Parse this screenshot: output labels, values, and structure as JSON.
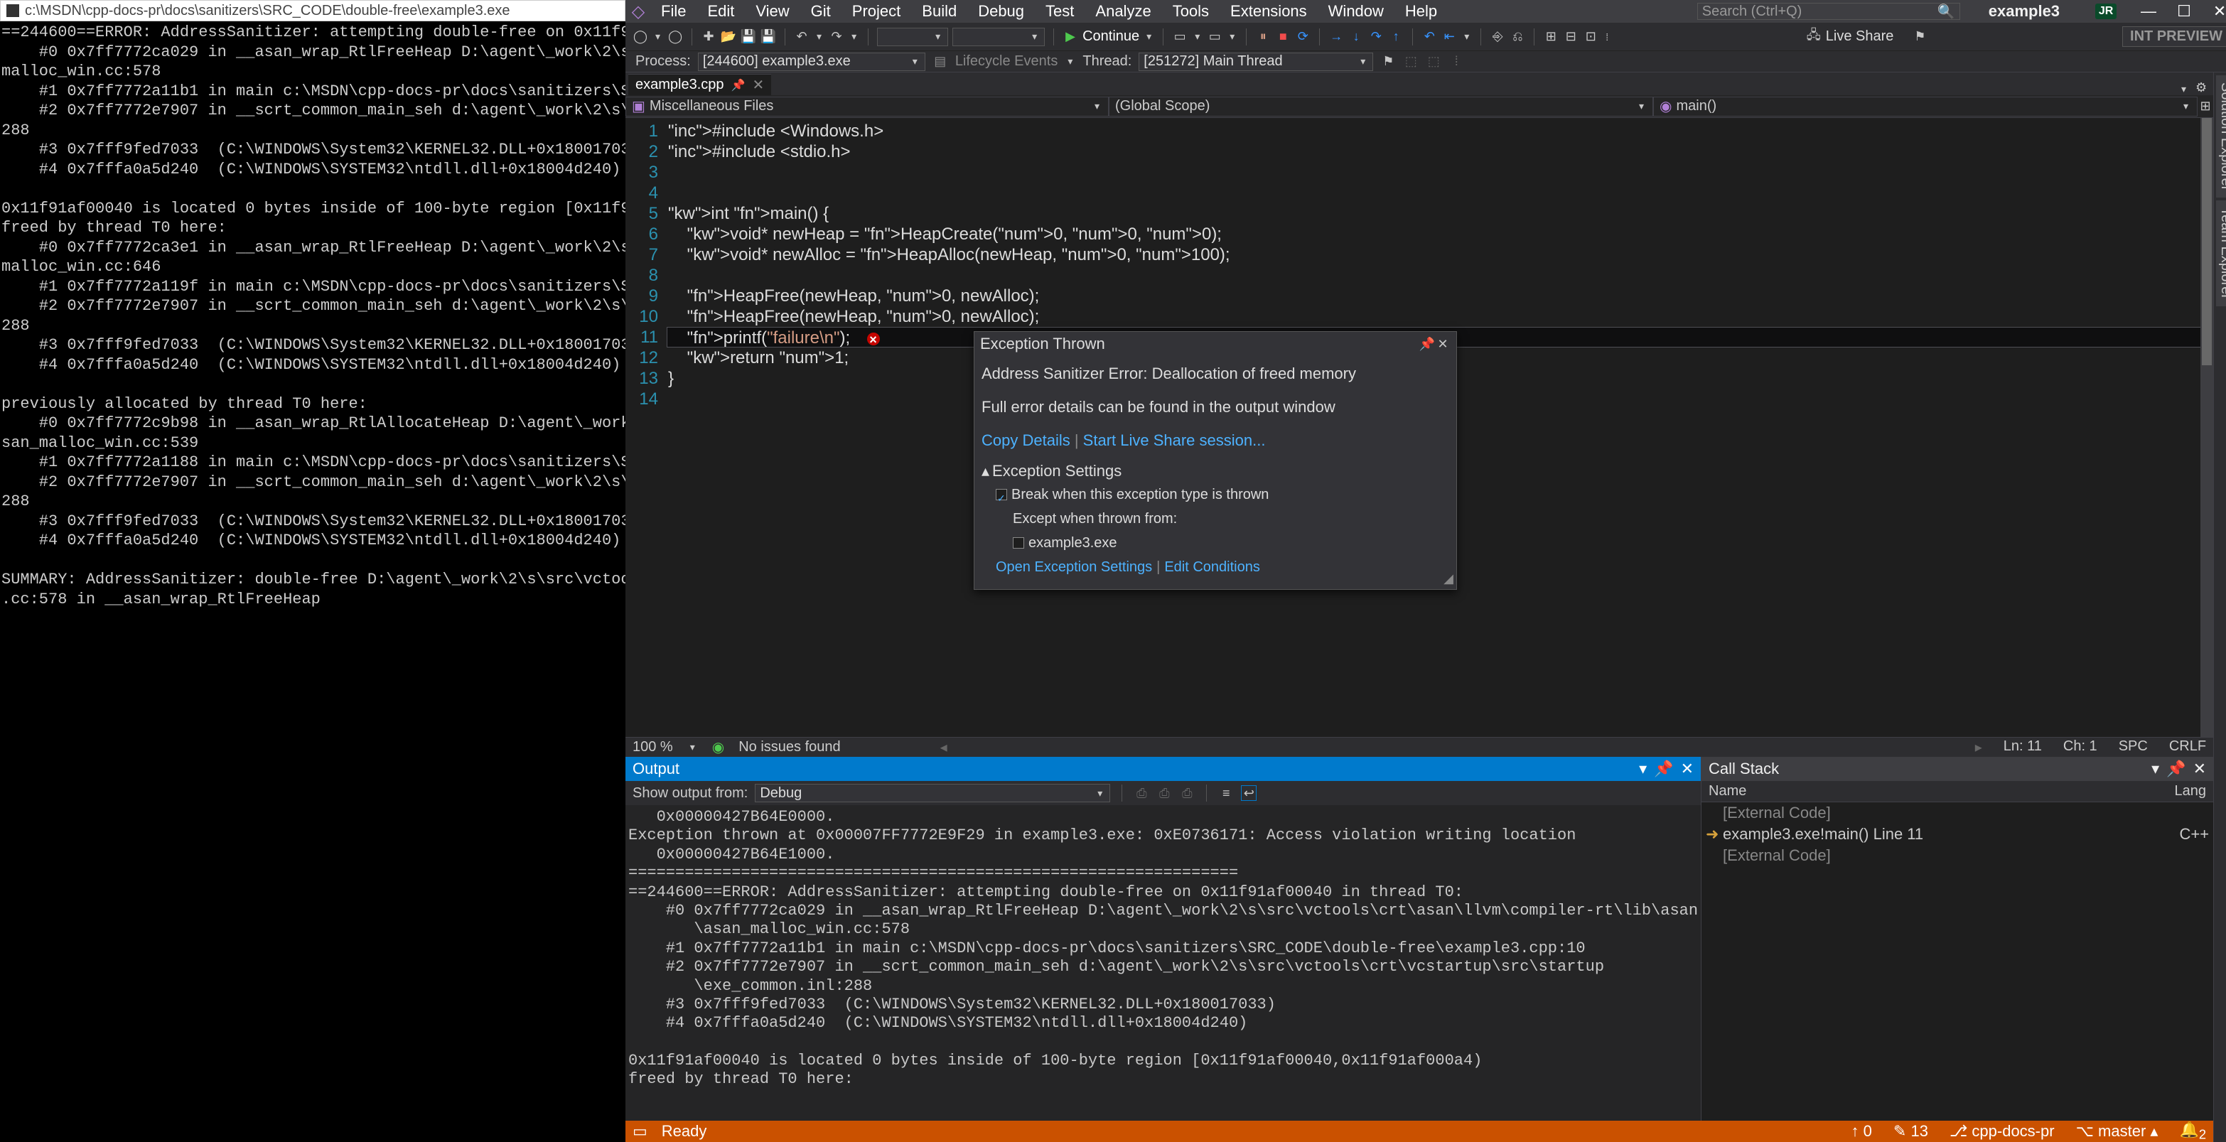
{
  "console": {
    "title": "c:\\MSDN\\cpp-docs-pr\\docs\\sanitizers\\SRC_CODE\\double-free\\example3.exe",
    "text": "==244600==ERROR: AddressSanitizer: attempting double-free on 0x11f91a\n    #0 0x7ff7772ca029 in __asan_wrap_RtlFreeHeap D:\\agent\\_work\\2\\s\\s\nmalloc_win.cc:578\n    #1 0x7ff7772a11b1 in main c:\\MSDN\\cpp-docs-pr\\docs\\sanitizers\\SRC\n    #2 0x7ff7772e7907 in __scrt_common_main_seh d:\\agent\\_work\\2\\s\\sr\n288\n    #3 0x7fff9fed7033  (C:\\WINDOWS\\System32\\KERNEL32.DLL+0x180017033)\n    #4 0x7fffa0a5d240  (C:\\WINDOWS\\SYSTEM32\\ntdll.dll+0x18004d240)\n\n0x11f91af00040 is located 0 bytes inside of 100-byte region [0x11f91a\nfreed by thread T0 here:\n    #0 0x7ff7772ca3e1 in __asan_wrap_RtlFreeHeap D:\\agent\\_work\\2\\s\\s\nmalloc_win.cc:646\n    #1 0x7ff7772a119f in main c:\\MSDN\\cpp-docs-pr\\docs\\sanitizers\\SRC\n    #2 0x7ff7772e7907 in __scrt_common_main_seh d:\\agent\\_work\\2\\s\\sr\n288\n    #3 0x7fff9fed7033  (C:\\WINDOWS\\System32\\KERNEL32.DLL+0x180017033)\n    #4 0x7fffa0a5d240  (C:\\WINDOWS\\SYSTEM32\\ntdll.dll+0x18004d240)\n\npreviously allocated by thread T0 here:\n    #0 0x7ff7772c9b98 in __asan_wrap_RtlAllocateHeap D:\\agent\\_work\\2\nsan_malloc_win.cc:539\n    #1 0x7ff7772a1188 in main c:\\MSDN\\cpp-docs-pr\\docs\\sanitizers\\SRC\n    #2 0x7ff7772e7907 in __scrt_common_main_seh d:\\agent\\_work\\2\\s\\sr\n288\n    #3 0x7fff9fed7033  (C:\\WINDOWS\\System32\\KERNEL32.DLL+0x180017033)\n    #4 0x7fffa0a5d240  (C:\\WINDOWS\\SYSTEM32\\ntdll.dll+0x18004d240)\n\nSUMMARY: AddressSanitizer: double-free D:\\agent\\_work\\2\\s\\src\\vctools\n.cc:578 in __asan_wrap_RtlFreeHeap"
  },
  "vs": {
    "menus": [
      "File",
      "Edit",
      "View",
      "Git",
      "Project",
      "Build",
      "Debug",
      "Test",
      "Analyze",
      "Tools",
      "Extensions",
      "Window",
      "Help"
    ],
    "search_placeholder": "Search (Ctrl+Q)",
    "solution": "example3",
    "user": "JR",
    "toolbar": {
      "continue_label": "Continue",
      "live_share": "Live Share",
      "int_preview": "INT PREVIEW"
    },
    "debugbar": {
      "process_label": "Process:",
      "process": "[244600] example3.exe",
      "lifecycle": "Lifecycle Events",
      "thread_label": "Thread:",
      "thread": "[251272] Main Thread"
    },
    "tab": "example3.cpp",
    "nav_container": "Miscellaneous Files",
    "nav_scope": "(Global Scope)",
    "nav_func": "main()",
    "code_lines": [
      "#include <Windows.h>",
      "#include <stdio.h>",
      "",
      "",
      "int main() {",
      "    void* newHeap = HeapCreate(0, 0, 0);",
      "    void* newAlloc = HeapAlloc(newHeap, 0, 100);",
      "",
      "    HeapFree(newHeap, 0, newAlloc);",
      "    HeapFree(newHeap, 0, newAlloc);",
      "    printf(\"failure\\n\");",
      "    return 1;",
      "}",
      ""
    ],
    "exception": {
      "title": "Exception Thrown",
      "message": "Address Sanitizer Error: Deallocation of freed memory",
      "detail": "Full error details can be found in the output window",
      "copy": "Copy Details",
      "liveshare": "Start Live Share session...",
      "settings_hdr": "Exception Settings",
      "break_label": "Break when this exception type is thrown",
      "except_label": "Except when thrown from:",
      "except_mod": "example3.exe",
      "open_settings": "Open Exception Settings",
      "edit_cond": "Edit Conditions"
    },
    "ed_status": {
      "zoom": "100 %",
      "issues": "No issues found",
      "ln": "Ln: 11",
      "ch": "Ch: 1",
      "spc": "SPC",
      "crlf": "CRLF"
    },
    "output": {
      "title": "Output",
      "show_from": "Show output from:",
      "source": "Debug",
      "text": "   0x00000427B64E0000.\nException thrown at 0x00007FF7772E9F29 in example3.exe: 0xE0736171: Access violation writing location\n   0x00000427B64E1000.\n=================================================================\n==244600==ERROR: AddressSanitizer: attempting double-free on 0x11f91af00040 in thread T0:\n    #0 0x7ff7772ca029 in __asan_wrap_RtlFreeHeap D:\\agent\\_work\\2\\s\\src\\vctools\\crt\\asan\\llvm\\compiler-rt\\lib\\asan\n       \\asan_malloc_win.cc:578\n    #1 0x7ff7772a11b1 in main c:\\MSDN\\cpp-docs-pr\\docs\\sanitizers\\SRC_CODE\\double-free\\example3.cpp:10\n    #2 0x7ff7772e7907 in __scrt_common_main_seh d:\\agent\\_work\\2\\s\\src\\vctools\\crt\\vcstartup\\src\\startup\n       \\exe_common.inl:288\n    #3 0x7fff9fed7033  (C:\\WINDOWS\\System32\\KERNEL32.DLL+0x180017033)\n    #4 0x7fffa0a5d240  (C:\\WINDOWS\\SYSTEM32\\ntdll.dll+0x18004d240)\n\n0x11f91af00040 is located 0 bytes inside of 100-byte region [0x11f91af00040,0x11f91af000a4)\nfreed by thread T0 here:"
    },
    "callstack": {
      "title": "Call Stack",
      "col_name": "Name",
      "col_lang": "Lang",
      "rows": [
        {
          "name": "[External Code]",
          "lang": "",
          "ext": true,
          "cur": false
        },
        {
          "name": "example3.exe!main() Line 11",
          "lang": "C++",
          "ext": false,
          "cur": true
        },
        {
          "name": "[External Code]",
          "lang": "",
          "ext": true,
          "cur": false
        }
      ]
    },
    "status": {
      "ready": "Ready",
      "up": "0",
      "down": "13",
      "repo": "cpp-docs-pr",
      "branch": "master",
      "errors": "2"
    },
    "side_tabs": [
      "Solution Explorer",
      "Team Explorer"
    ]
  }
}
